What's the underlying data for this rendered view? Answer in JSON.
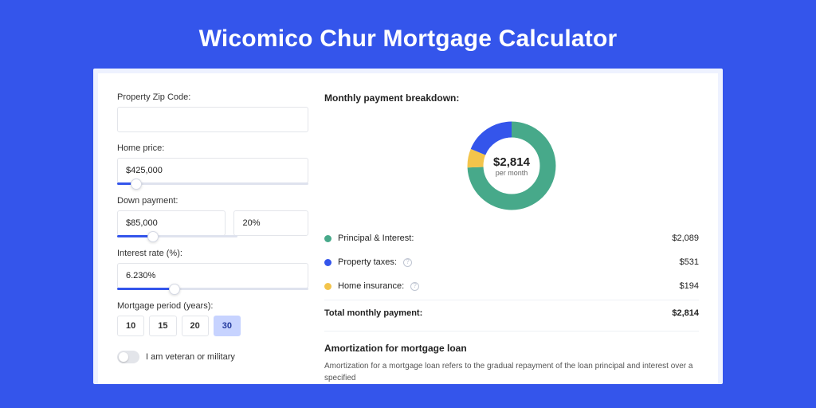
{
  "page": {
    "title": "Wicomico Chur Mortgage Calculator"
  },
  "colors": {
    "principal": "#47a98a",
    "taxes": "#3455eb",
    "insurance": "#f3c44b"
  },
  "form": {
    "zip": {
      "label": "Property Zip Code:",
      "value": ""
    },
    "home_price": {
      "label": "Home price:",
      "value": "$425,000",
      "slider_pct": 10
    },
    "down_payment": {
      "label": "Down payment:",
      "value": "$85,000",
      "pct_value": "20%",
      "slider_pct": 20
    },
    "interest": {
      "label": "Interest rate (%):",
      "value": "6.230%",
      "slider_pct": 30
    },
    "period": {
      "label": "Mortgage period (years):",
      "options": [
        "10",
        "15",
        "20",
        "30"
      ],
      "selected": "30"
    },
    "veteran": {
      "label": "I am veteran or military",
      "checked": false
    }
  },
  "breakdown": {
    "title": "Monthly payment breakdown:",
    "center_value": "$2,814",
    "center_sub": "per month",
    "rows": [
      {
        "label": "Principal & Interest:",
        "value": "$2,089",
        "dot": "#47a98a",
        "info": false
      },
      {
        "label": "Property taxes:",
        "value": "$531",
        "dot": "#3455eb",
        "info": true
      },
      {
        "label": "Home insurance:",
        "value": "$194",
        "dot": "#f3c44b",
        "info": true
      }
    ],
    "total_label": "Total monthly payment:",
    "total_value": "$2,814"
  },
  "amort": {
    "title": "Amortization for mortgage loan",
    "text": "Amortization for a mortgage loan refers to the gradual repayment of the loan principal and interest over a specified"
  },
  "chart_data": {
    "type": "pie",
    "title": "Monthly payment breakdown",
    "series": [
      {
        "name": "Principal & Interest",
        "value": 2089,
        "color": "#47a98a"
      },
      {
        "name": "Property taxes",
        "value": 531,
        "color": "#3455eb"
      },
      {
        "name": "Home insurance",
        "value": 194,
        "color": "#f3c44b"
      }
    ],
    "total": 2814
  }
}
